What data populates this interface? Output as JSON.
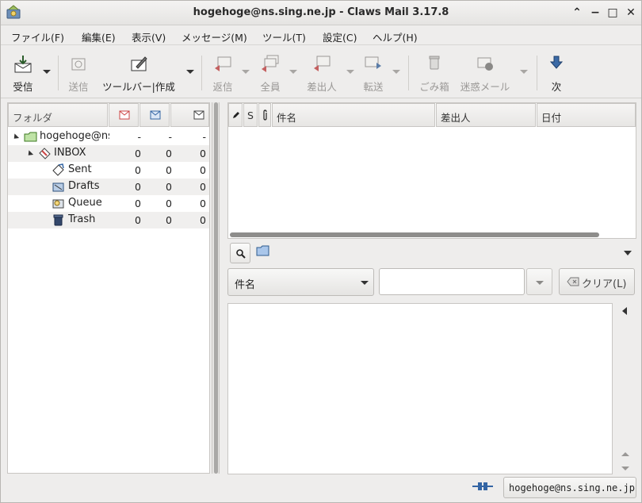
{
  "window": {
    "title": "hogehoge@ns.sing.ne.jp - Claws Mail 3.17.8"
  },
  "window_controls": {
    "up": "⌃",
    "minimize": "−",
    "maximize": "□",
    "close": "✕"
  },
  "menubar": {
    "items": [
      "ファイル(F)",
      "編集(E)",
      "表示(V)",
      "メッセージ(M)",
      "ツール(T)",
      "設定(C)",
      "ヘルプ(H)"
    ]
  },
  "toolbar": {
    "receive": "受信",
    "send": "送信",
    "compose": "ツールバー|作成",
    "reply": "返信",
    "reply_all": "全員",
    "reply_sender": "差出人",
    "forward": "転送",
    "trash": "ごみ箱",
    "spam": "迷惑メール",
    "next": "次"
  },
  "folder_pane": {
    "header": "フォルダ",
    "folders": [
      {
        "name": "hogehoge@ns",
        "new": "-",
        "unread": "-",
        "total": "-"
      },
      {
        "name": "INBOX",
        "new": "0",
        "unread": "0",
        "total": "0"
      },
      {
        "name": "Sent",
        "new": "0",
        "unread": "0",
        "total": "0"
      },
      {
        "name": "Drafts",
        "new": "0",
        "unread": "0",
        "total": "0"
      },
      {
        "name": "Queue",
        "new": "0",
        "unread": "0",
        "total": "0"
      },
      {
        "name": "Trash",
        "new": "0",
        "unread": "0",
        "total": "0"
      }
    ]
  },
  "message_list": {
    "columns": {
      "mark": "",
      "status": "S",
      "attach": "",
      "subject": "件名",
      "from": "差出人",
      "date": "日付"
    }
  },
  "quick_search": {
    "type_selected": "件名",
    "value": "",
    "clear_label": "クリア(L)"
  },
  "status": {
    "account": "hogehoge@ns.sing.ne.jp"
  },
  "colors": {
    "accent": "#3465a4",
    "folder": "#4a8a3a"
  }
}
